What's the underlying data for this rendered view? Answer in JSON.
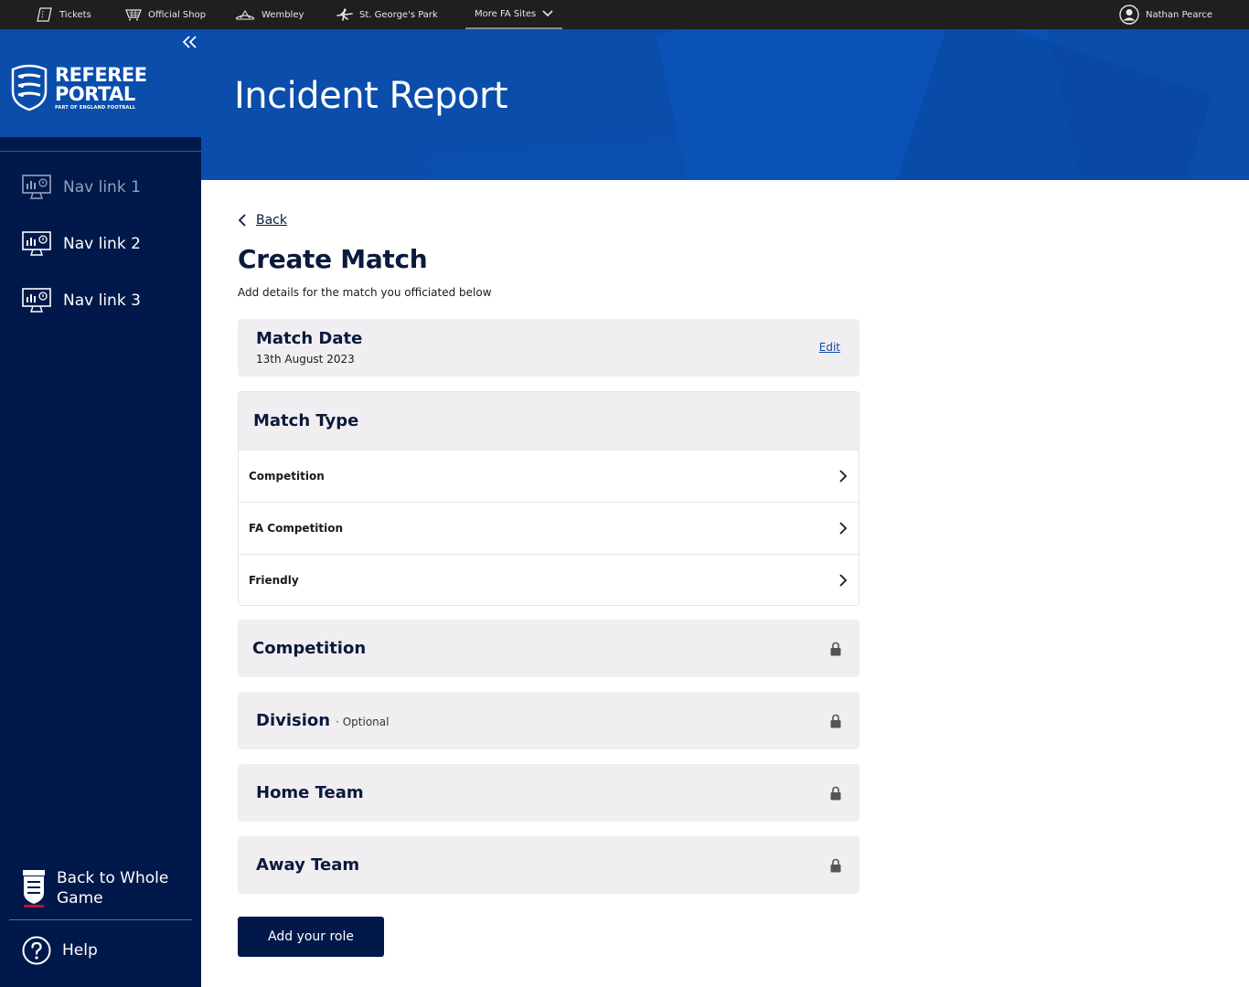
{
  "topbar": {
    "links": [
      {
        "label": "Tickets",
        "icon": "ticket-icon"
      },
      {
        "label": "Official Shop",
        "icon": "shopping-basket-icon"
      },
      {
        "label": "Wembley",
        "icon": "stadium-icon"
      },
      {
        "label": "St. George's Park",
        "icon": "plane-icon"
      },
      {
        "label": "More FA Sites",
        "icon": "chevron-down-icon"
      }
    ],
    "user_name": "Nathan Pearce"
  },
  "sidebar": {
    "logo": {
      "line1": "REFEREE",
      "line2": "PORTAL",
      "line3": "PART OF ENGLAND FOOTBALL"
    },
    "nav": [
      {
        "label": "Nav link 1",
        "state": "dimmed"
      },
      {
        "label": "Nav link 2",
        "state": "normal"
      },
      {
        "label": "Nav link 3",
        "state": "normal"
      }
    ],
    "back_to_whole_game": "Back to Whole Game",
    "help": "Help"
  },
  "hero": {
    "title": "Incident Report"
  },
  "main": {
    "back_label": "Back",
    "title": "Create Match",
    "subtitle": "Add details for the match you officiated below",
    "match_date": {
      "label": "Match Date",
      "value": "13th August 2023",
      "edit_label": "Edit"
    },
    "match_type": {
      "label": "Match Type",
      "options": [
        "Competition",
        "FA Competition",
        "Friendly"
      ]
    },
    "locked_sections": [
      {
        "label": "Competition",
        "note": ""
      },
      {
        "label": "Division",
        "note": "· Optional"
      },
      {
        "label": "Home Team",
        "note": ""
      },
      {
        "label": "Away Team",
        "note": ""
      }
    ],
    "submit_label": "Add your role"
  },
  "colors": {
    "brand_blue": "#0a4dab",
    "navy": "#00194a",
    "topbar": "#1f1f1f",
    "card_bg": "#f1eef2"
  }
}
